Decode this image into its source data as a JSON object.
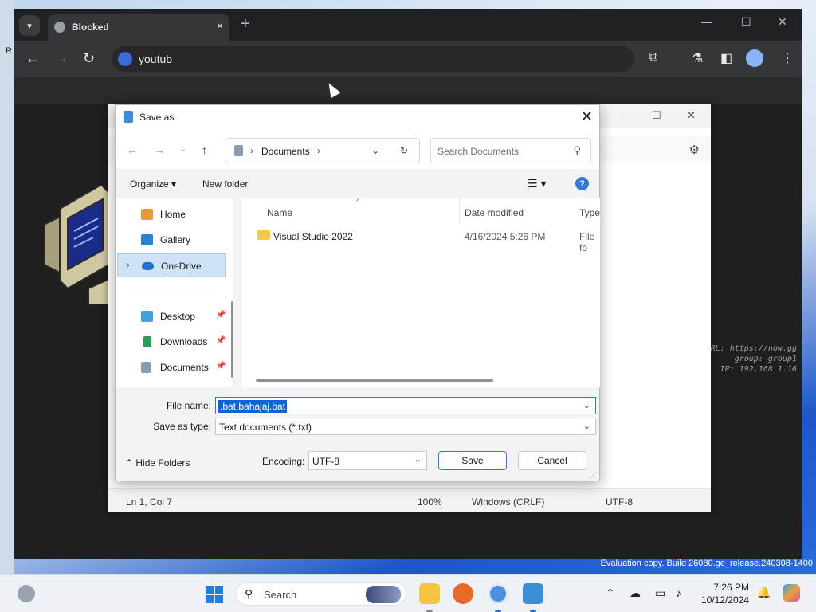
{
  "browser": {
    "tab_title": "Blocked",
    "tab_close": "×",
    "new_tab": "+",
    "omnibox_value": "youtub",
    "overlay_lines": [
      "RL: https://now.gg",
      "group: group1",
      "IP: 192.168.1.16"
    ]
  },
  "notepad": {
    "status_position": "Ln 1, Col 7",
    "status_zoom": "100%",
    "status_line_endings": "Windows (CRLF)",
    "status_encoding": "UTF-8"
  },
  "dialog": {
    "title": "Save as",
    "breadcrumb": "Documents",
    "search_placeholder": "Search Documents",
    "organize_label": "Organize",
    "new_folder_label": "New folder",
    "nav_items": [
      {
        "label": "Home",
        "icon": "home-icon"
      },
      {
        "label": "Gallery",
        "icon": "gallery-icon"
      },
      {
        "label": "OneDrive",
        "icon": "onedrive-icon"
      },
      {
        "label": "Desktop",
        "icon": "desktop-icon"
      },
      {
        "label": "Downloads",
        "icon": "downloads-icon"
      },
      {
        "label": "Documents",
        "icon": "documents-icon"
      }
    ],
    "columns": [
      "Name",
      "Date modified",
      "Type"
    ],
    "files": [
      {
        "name": "Visual Studio 2022",
        "date": "4/16/2024 5:26 PM",
        "type": "File fo"
      }
    ],
    "file_name_label": "File name:",
    "file_name_value": ".bat.bahajaj.bat",
    "save_as_type_label": "Save as type:",
    "save_as_type_value": "Text documents (*.txt)",
    "hide_folders_label": "Hide Folders",
    "encoding_label": "Encoding:",
    "encoding_value": "UTF-8",
    "save_label": "Save",
    "cancel_label": "Cancel"
  },
  "watermark": "Evaluation copy. Build 26080.ge_release.240308-1400",
  "taskbar": {
    "search_label": "Search",
    "time": "7:26 PM",
    "date": "10/12/2024"
  },
  "colors": {
    "accent": "#0a64d6",
    "folder": "#f6c945",
    "chrome_bg": "#202124"
  }
}
